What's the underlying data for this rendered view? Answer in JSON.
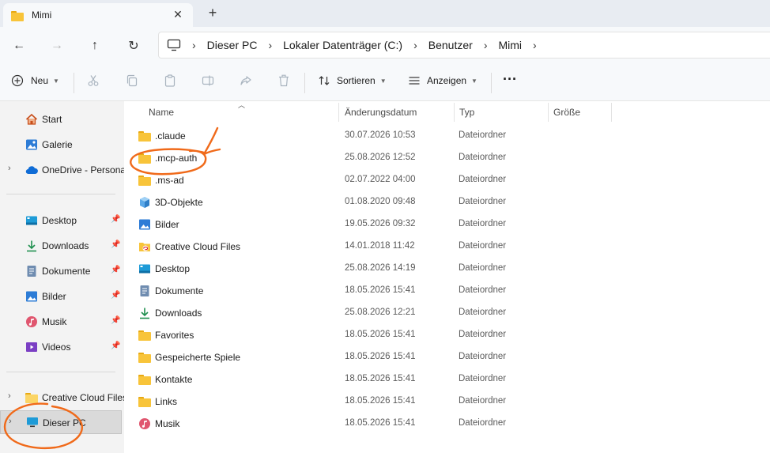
{
  "window": {
    "tab_title": "Mimi",
    "tab_close": "✕",
    "new_tab": "+"
  },
  "nav": {
    "back": "←",
    "forward": "→",
    "up": "↑",
    "refresh": "↻"
  },
  "breadcrumb": [
    "Dieser PC",
    "Lokaler Datenträger (C:)",
    "Benutzer",
    "Mimi"
  ],
  "commandbar": {
    "new_label": "Neu",
    "sort_label": "Sortieren",
    "view_label": "Anzeigen",
    "more_label": "···"
  },
  "sidebar": {
    "items": [
      {
        "label": "Start",
        "icon": "home-icon"
      },
      {
        "label": "Galerie",
        "icon": "gallery-icon"
      },
      {
        "label": "OneDrive - Persona",
        "icon": "onedrive-icon"
      },
      {
        "label": "Desktop",
        "icon": "desktop-icon"
      },
      {
        "label": "Downloads",
        "icon": "download-icon"
      },
      {
        "label": "Dokumente",
        "icon": "document-icon"
      },
      {
        "label": "Bilder",
        "icon": "pictures-icon"
      },
      {
        "label": "Musik",
        "icon": "music-icon"
      },
      {
        "label": "Videos",
        "icon": "video-icon"
      },
      {
        "label": "Creative Cloud Files",
        "icon": "folder-icon"
      },
      {
        "label": "Dieser PC",
        "icon": "computer-icon"
      }
    ]
  },
  "columns": {
    "name": "Name",
    "date": "Änderungsdatum",
    "type": "Typ",
    "size": "Größe"
  },
  "files": [
    {
      "name": ".claude",
      "date": "30.07.2026 10:53",
      "type": "Dateiordner",
      "icon": "folder-icon"
    },
    {
      "name": ".mcp-auth",
      "date": "25.08.2026 12:52",
      "type": "Dateiordner",
      "icon": "folder-icon"
    },
    {
      "name": ".ms-ad",
      "date": "02.07.2022 04:00",
      "type": "Dateiordner",
      "icon": "folder-icon"
    },
    {
      "name": "3D-Objekte",
      "date": "01.08.2020 09:48",
      "type": "Dateiordner",
      "icon": "cube-icon"
    },
    {
      "name": "Bilder",
      "date": "19.05.2026 09:32",
      "type": "Dateiordner",
      "icon": "pictures-icon"
    },
    {
      "name": "Creative Cloud Files",
      "date": "14.01.2018 11:42",
      "type": "Dateiordner",
      "icon": "creative-cloud-folder-icon"
    },
    {
      "name": "Desktop",
      "date": "25.08.2026 14:19",
      "type": "Dateiordner",
      "icon": "desktop-icon"
    },
    {
      "name": "Dokumente",
      "date": "18.05.2026 15:41",
      "type": "Dateiordner",
      "icon": "document-icon"
    },
    {
      "name": "Downloads",
      "date": "25.08.2026 12:21",
      "type": "Dateiordner",
      "icon": "download-icon"
    },
    {
      "name": "Favorites",
      "date": "18.05.2026 15:41",
      "type": "Dateiordner",
      "icon": "folder-icon"
    },
    {
      "name": "Gespeicherte Spiele",
      "date": "18.05.2026 15:41",
      "type": "Dateiordner",
      "icon": "folder-icon"
    },
    {
      "name": "Kontakte",
      "date": "18.05.2026 15:41",
      "type": "Dateiordner",
      "icon": "folder-icon"
    },
    {
      "name": "Links",
      "date": "18.05.2026 15:41",
      "type": "Dateiordner",
      "icon": "folder-icon"
    },
    {
      "name": "Musik",
      "date": "18.05.2026 15:41",
      "type": "Dateiordner",
      "icon": "music-icon"
    }
  ],
  "colors": {
    "folder_yellow": "#f8c43a",
    "annotation_orange": "#f06a1a",
    "selected_bg": "#dadada"
  }
}
